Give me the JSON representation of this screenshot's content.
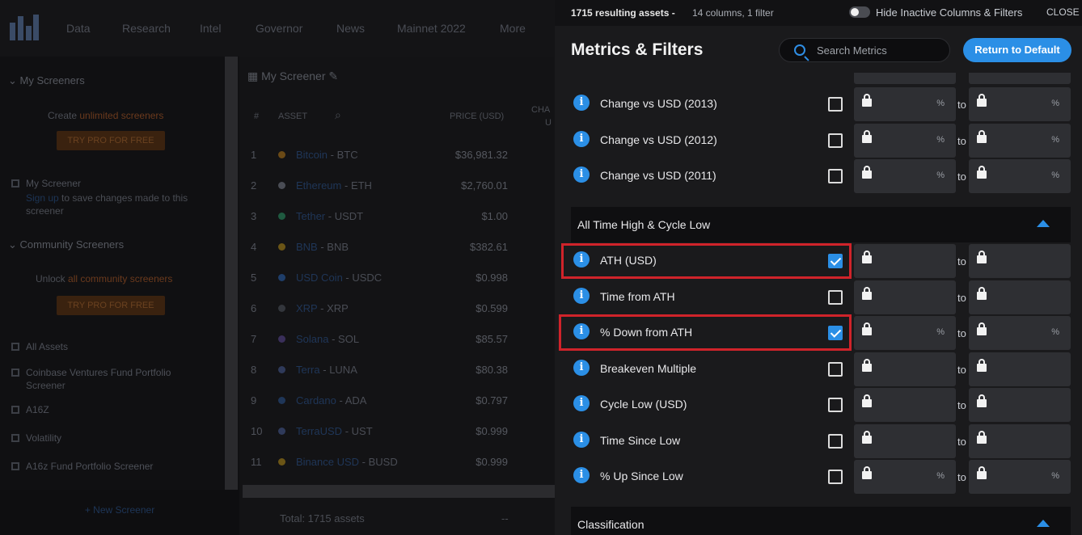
{
  "topnav": {
    "items": [
      "Data",
      "Research",
      "Intel",
      "Governor",
      "News",
      "Mainnet 2022",
      "More"
    ]
  },
  "sidebar": {
    "my_screeners_heading": "My Screeners",
    "create_prefix": "Create",
    "create_highlight": "unlimited screeners",
    "try_pro_label": "TRY PRO FOR FREE",
    "my_screener_label": "My Screener",
    "signup_link": "Sign up",
    "signup_rest": "to save changes made to this",
    "signup_rest2": "screener",
    "community_heading": "Community Screeners",
    "unlock_prefix": "Unlock",
    "unlock_highlight": "all community screeners",
    "try_pro_label2": "TRY PRO FOR FREE",
    "links": [
      "All Assets",
      "Coinbase Ventures Fund Portfolio",
      "Screener",
      "A16Z",
      "Volatility",
      "A16z Fund Portfolio Screener"
    ],
    "new_screener": "+ New Screener"
  },
  "table": {
    "title": "My Screener",
    "headers": {
      "num": "#",
      "asset": "ASSET",
      "price": "PRICE (USD)",
      "change": "CHA",
      "change2": "U"
    },
    "rows": [
      {
        "num": "1",
        "name": "Bitcoin",
        "sym": "- BTC",
        "price": "$36,981.32",
        "color": "#6b4a16"
      },
      {
        "num": "2",
        "name": "Ethereum",
        "sym": "- ETH",
        "price": "$2,760.01",
        "color": "#4a4d55"
      },
      {
        "num": "3",
        "name": "Tether",
        "sym": "- USDT",
        "price": "$1.00",
        "color": "#1f5a40"
      },
      {
        "num": "4",
        "name": "BNB",
        "sym": "- BNB",
        "price": "$382.61",
        "color": "#6b5516"
      },
      {
        "num": "5",
        "name": "USD Coin",
        "sym": "- USDC",
        "price": "$0.998",
        "color": "#1f3e6a"
      },
      {
        "num": "6",
        "name": "XRP",
        "sym": "- XRP",
        "price": "$0.599",
        "color": "#33363c"
      },
      {
        "num": "7",
        "name": "Solana",
        "sym": "- SOL",
        "price": "$85.57",
        "color": "#3a2f5a"
      },
      {
        "num": "8",
        "name": "Terra",
        "sym": "- LUNA",
        "price": "$80.38",
        "color": "#2f3a5a"
      },
      {
        "num": "9",
        "name": "Cardano",
        "sym": "- ADA",
        "price": "$0.797",
        "color": "#1f3658"
      },
      {
        "num": "10",
        "name": "TerraUSD",
        "sym": "- UST",
        "price": "$0.999",
        "color": "#2f3a5a"
      },
      {
        "num": "11",
        "name": "Binance USD",
        "sym": "- BUSD",
        "price": "$0.999",
        "color": "#6b5516"
      }
    ],
    "total": "Total: 1715 assets",
    "total_dash": "--"
  },
  "panel": {
    "result_count": "1715 resulting assets -",
    "result_meta": "14 columns, 1 filter",
    "toggle_label": "Hide Inactive Columns & Filters",
    "close_label": "CLOSE",
    "title": "Metrics & Filters",
    "search_placeholder": "Search Metrics",
    "default_button": "Return to Default",
    "to_label": "to",
    "info_glyph": "i",
    "metrics_top": [
      {
        "label": "Change vs USD (2013)",
        "checked": false,
        "unit": "%"
      },
      {
        "label": "Change vs USD (2012)",
        "checked": false,
        "unit": "%"
      },
      {
        "label": "Change vs USD (2011)",
        "checked": false,
        "unit": "%"
      }
    ],
    "section_ath": "All Time High & Cycle Low",
    "metrics_ath": [
      {
        "label": "ATH (USD)",
        "checked": true,
        "unit": ""
      },
      {
        "label": "Time from ATH",
        "checked": false,
        "unit": ""
      },
      {
        "label": "% Down from ATH",
        "checked": true,
        "unit": "%"
      },
      {
        "label": "Breakeven Multiple",
        "checked": false,
        "unit": ""
      },
      {
        "label": "Cycle Low (USD)",
        "checked": false,
        "unit": ""
      },
      {
        "label": "Time Since Low",
        "checked": false,
        "unit": ""
      },
      {
        "label": "% Up Since Low",
        "checked": false,
        "unit": "%"
      }
    ],
    "section_classification": "Classification"
  },
  "colors": {
    "accent": "#2b8fe6",
    "highlight": "#d0232a",
    "panel_bg": "#1a1a1c",
    "input_bg": "#2e2f33"
  }
}
